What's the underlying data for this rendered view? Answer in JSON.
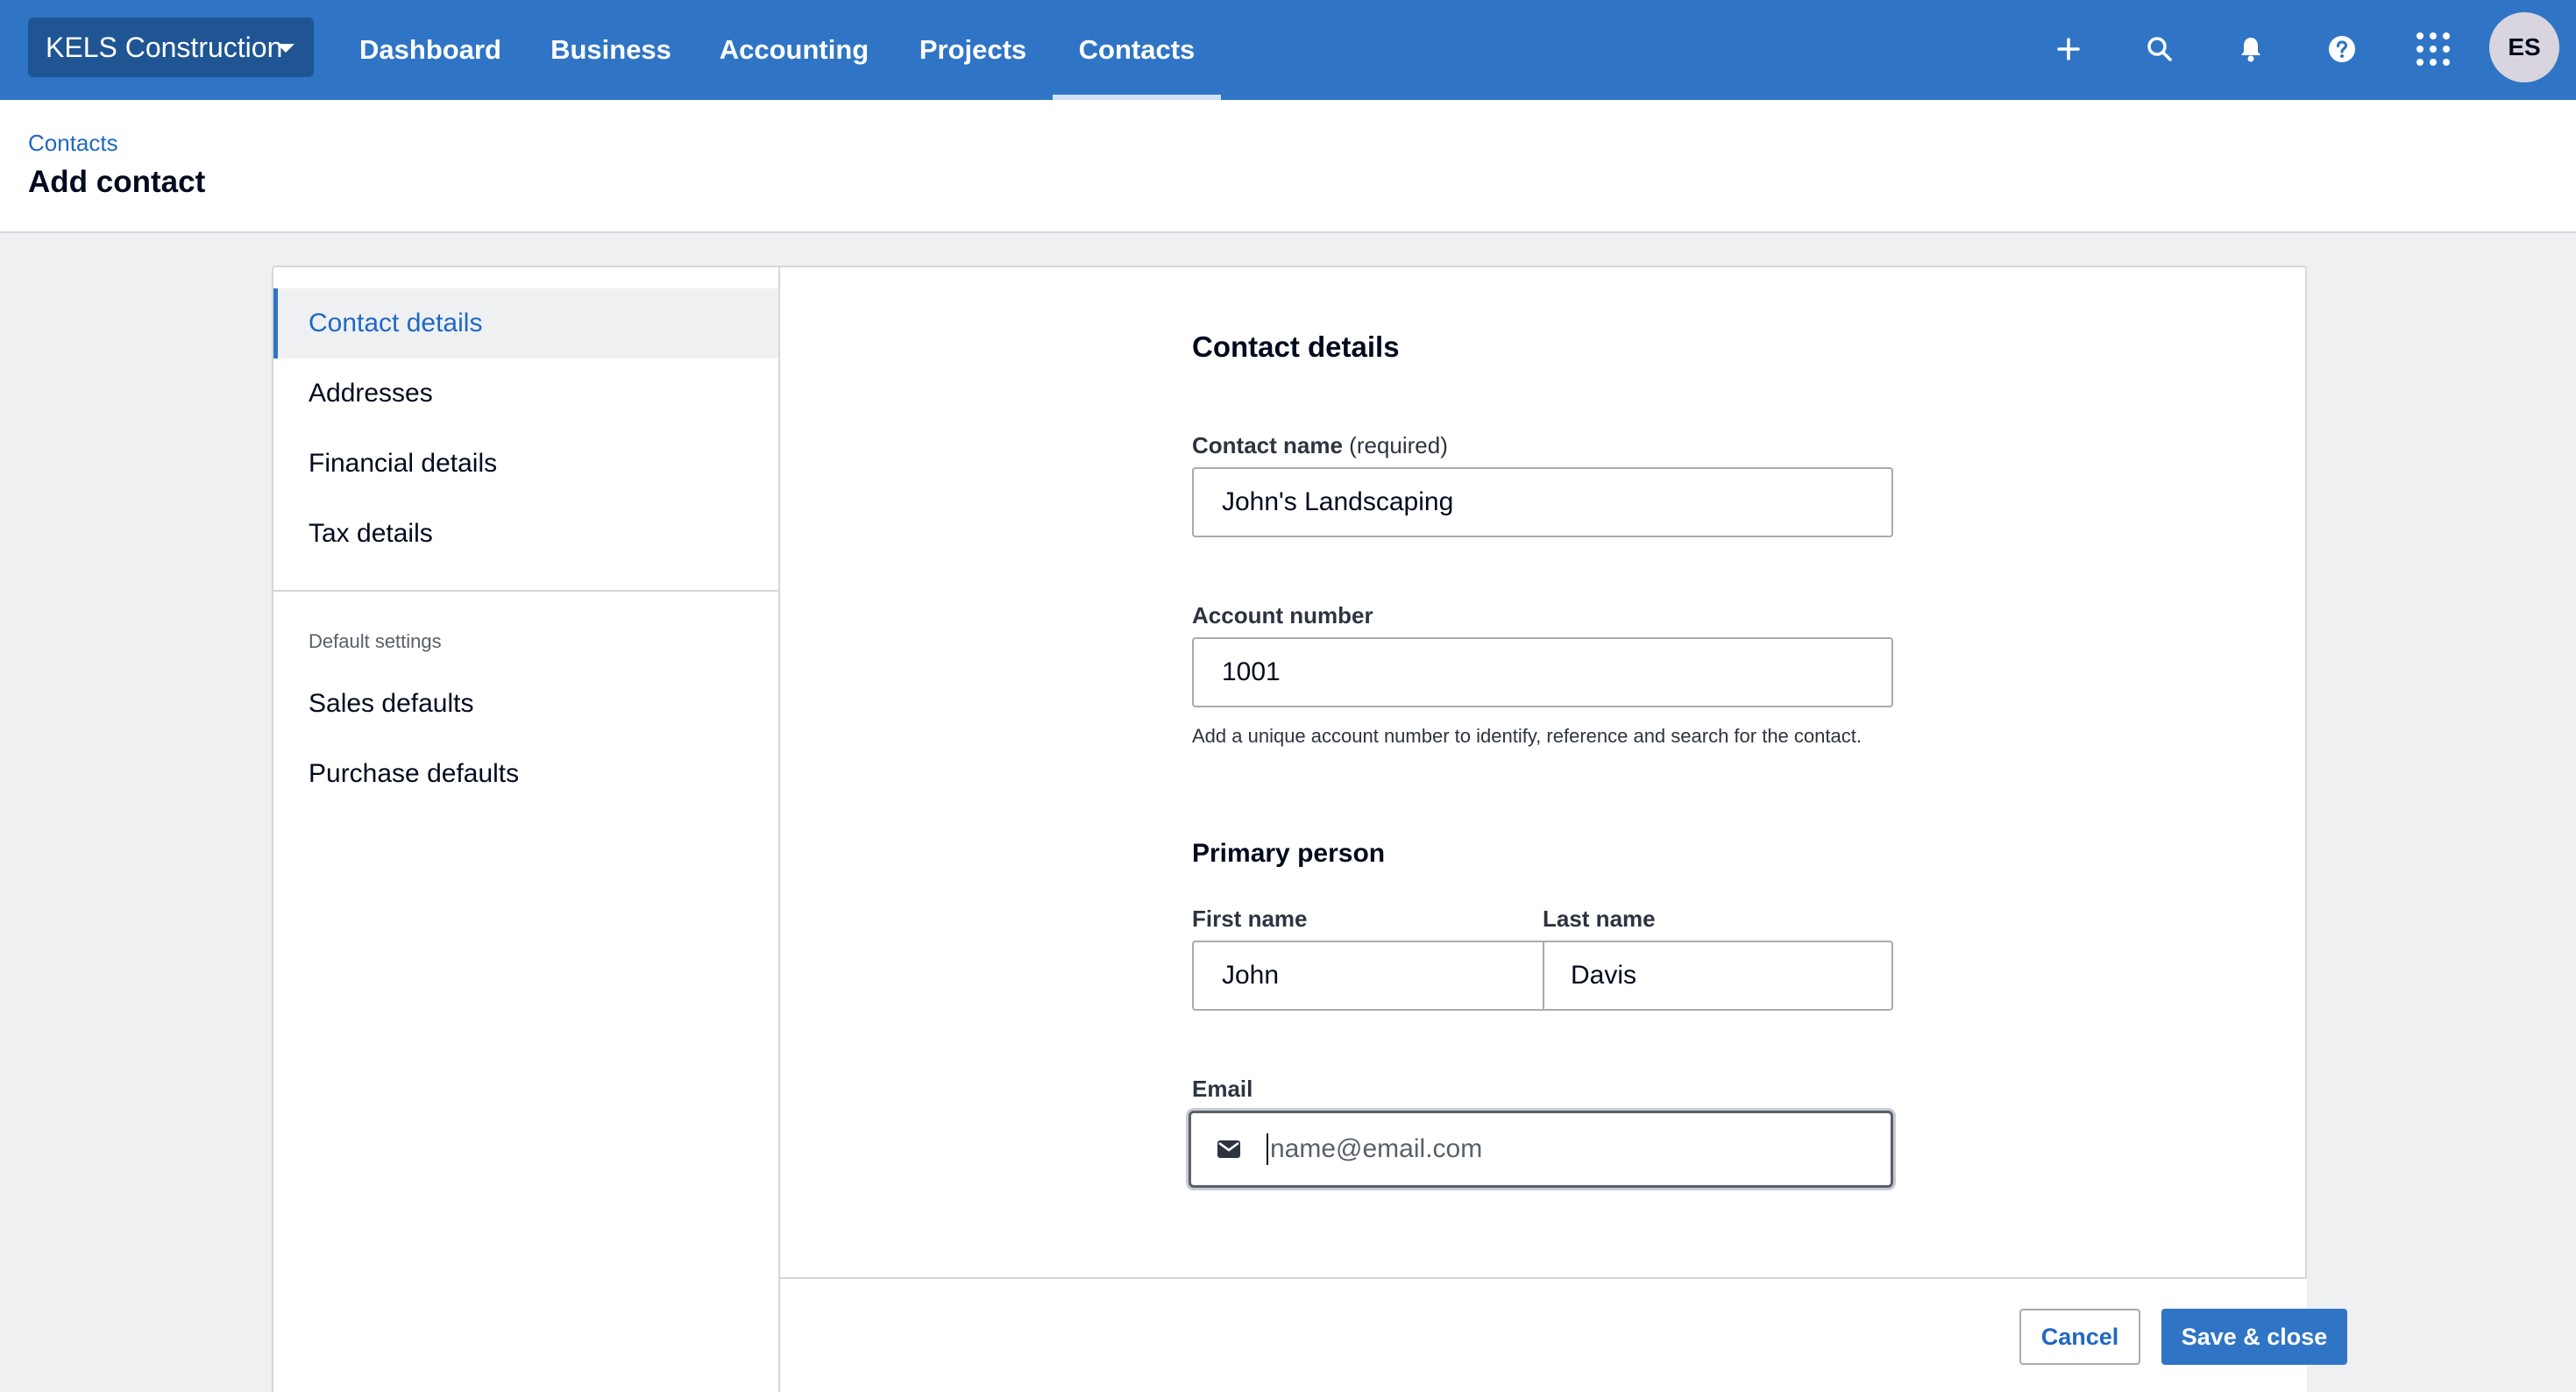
{
  "topnav": {
    "org_name": "KELS Construction",
    "items": [
      {
        "label": "Dashboard"
      },
      {
        "label": "Business"
      },
      {
        "label": "Accounting"
      },
      {
        "label": "Projects"
      },
      {
        "label": "Contacts"
      }
    ],
    "active_item": "Contacts",
    "icons": [
      "plus-icon",
      "search-icon",
      "bell-icon",
      "help-icon",
      "app-grid-icon"
    ],
    "avatar_initials": "ES",
    "colors": {
      "nav_bg": "#3075c5",
      "org_btn_bg": "#1f5593"
    }
  },
  "header": {
    "breadcrumb": "Contacts",
    "title": "Add contact"
  },
  "sidebar": {
    "items": [
      {
        "label": "Contact details"
      },
      {
        "label": "Addresses"
      },
      {
        "label": "Financial details"
      },
      {
        "label": "Tax details"
      }
    ],
    "section_caption": "Default settings",
    "default_items": [
      {
        "label": "Sales defaults"
      },
      {
        "label": "Purchase defaults"
      }
    ],
    "active_item": "Contact details"
  },
  "form": {
    "section_title": "Contact details",
    "contact_name": {
      "label": "Contact name",
      "required_note": "(required)",
      "value": "John's Landscaping"
    },
    "account_number": {
      "label": "Account number",
      "value": "1001",
      "hint": "Add a unique account number to identify, reference and search for the contact."
    },
    "primary_person": {
      "title": "Primary person",
      "first_name": {
        "label": "First name",
        "value": "John"
      },
      "last_name": {
        "label": "Last name",
        "value": "Davis"
      }
    },
    "email": {
      "label": "Email",
      "placeholder": "name@email.com",
      "value": ""
    }
  },
  "footer": {
    "cancel_label": "Cancel",
    "save_label": "Save & close",
    "colors": {
      "primary": "#3075c5"
    }
  }
}
